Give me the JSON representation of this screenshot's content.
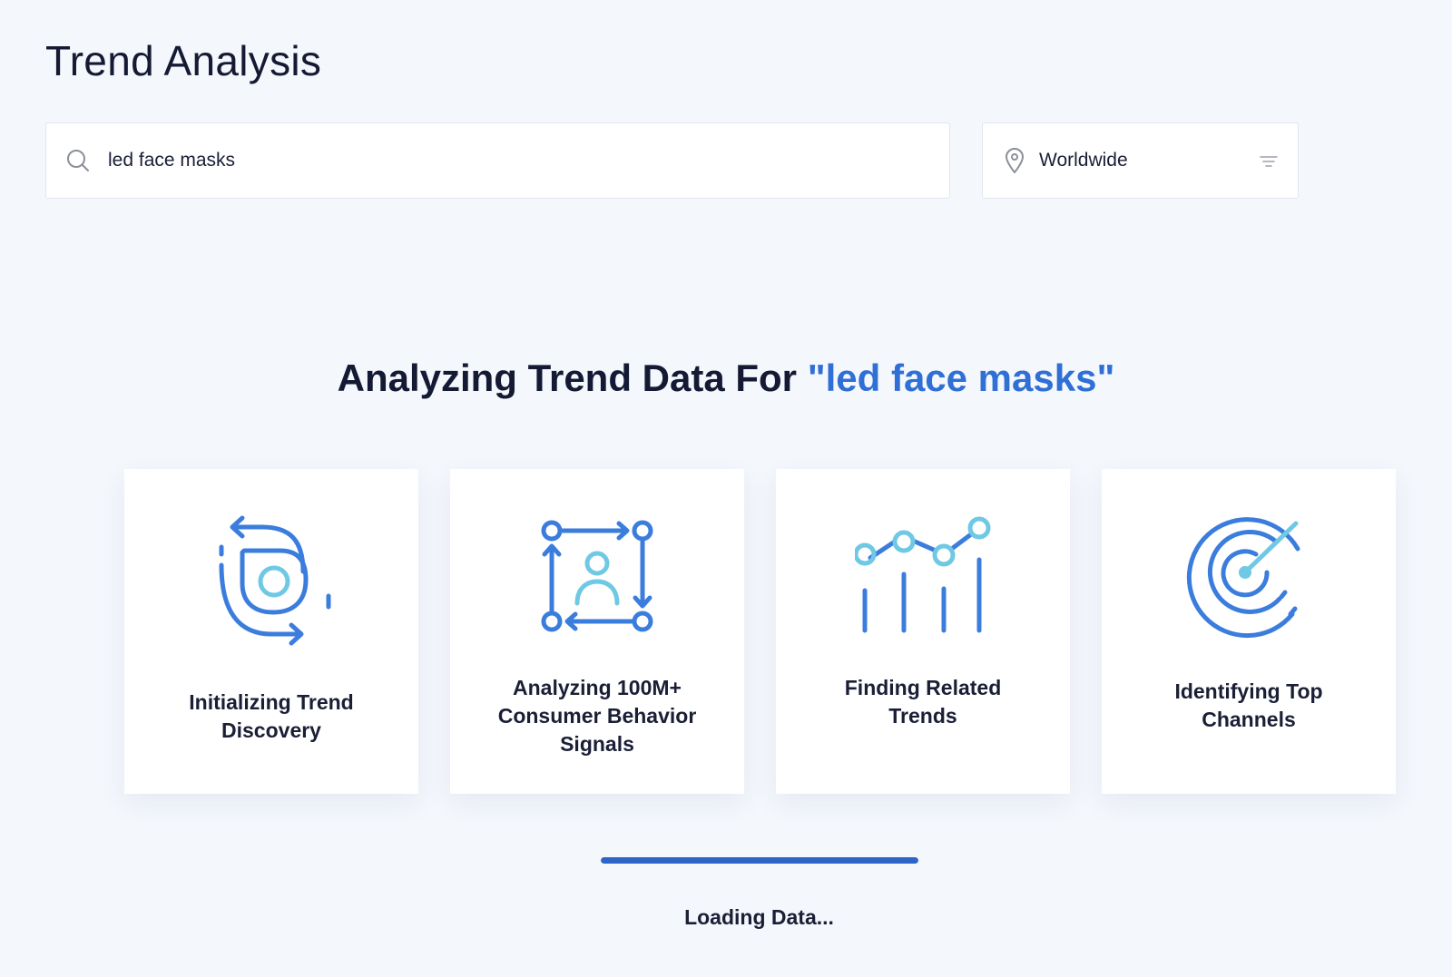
{
  "page": {
    "title": "Trend Analysis"
  },
  "search": {
    "value": "led face masks",
    "placeholder": ""
  },
  "location": {
    "value": "Worldwide"
  },
  "analysis": {
    "heading_prefix": "Analyzing Trend Data For ",
    "heading_query": "\"led face masks\""
  },
  "steps": [
    {
      "label_lines": [
        "Initializing Trend",
        "Discovery"
      ],
      "icon": "cycle-target-icon"
    },
    {
      "label_lines": [
        "Analyzing 100M+",
        "Consumer Behavior",
        "Signals"
      ],
      "icon": "user-network-icon"
    },
    {
      "label_lines": [
        "Finding Related",
        "Trends"
      ],
      "icon": "trend-chart-icon"
    },
    {
      "label_lines": [
        "Identifying Top",
        "Channels"
      ],
      "icon": "radar-icon"
    }
  ],
  "progress": {
    "fraction": 1.0
  },
  "status": {
    "text": "Loading Data..."
  },
  "colors": {
    "accent": "#2f6fd6",
    "icon_primary": "#3b7ddd",
    "icon_secondary": "#6fc8e4",
    "progress": "#2d64c8",
    "background": "#f4f7fc"
  }
}
